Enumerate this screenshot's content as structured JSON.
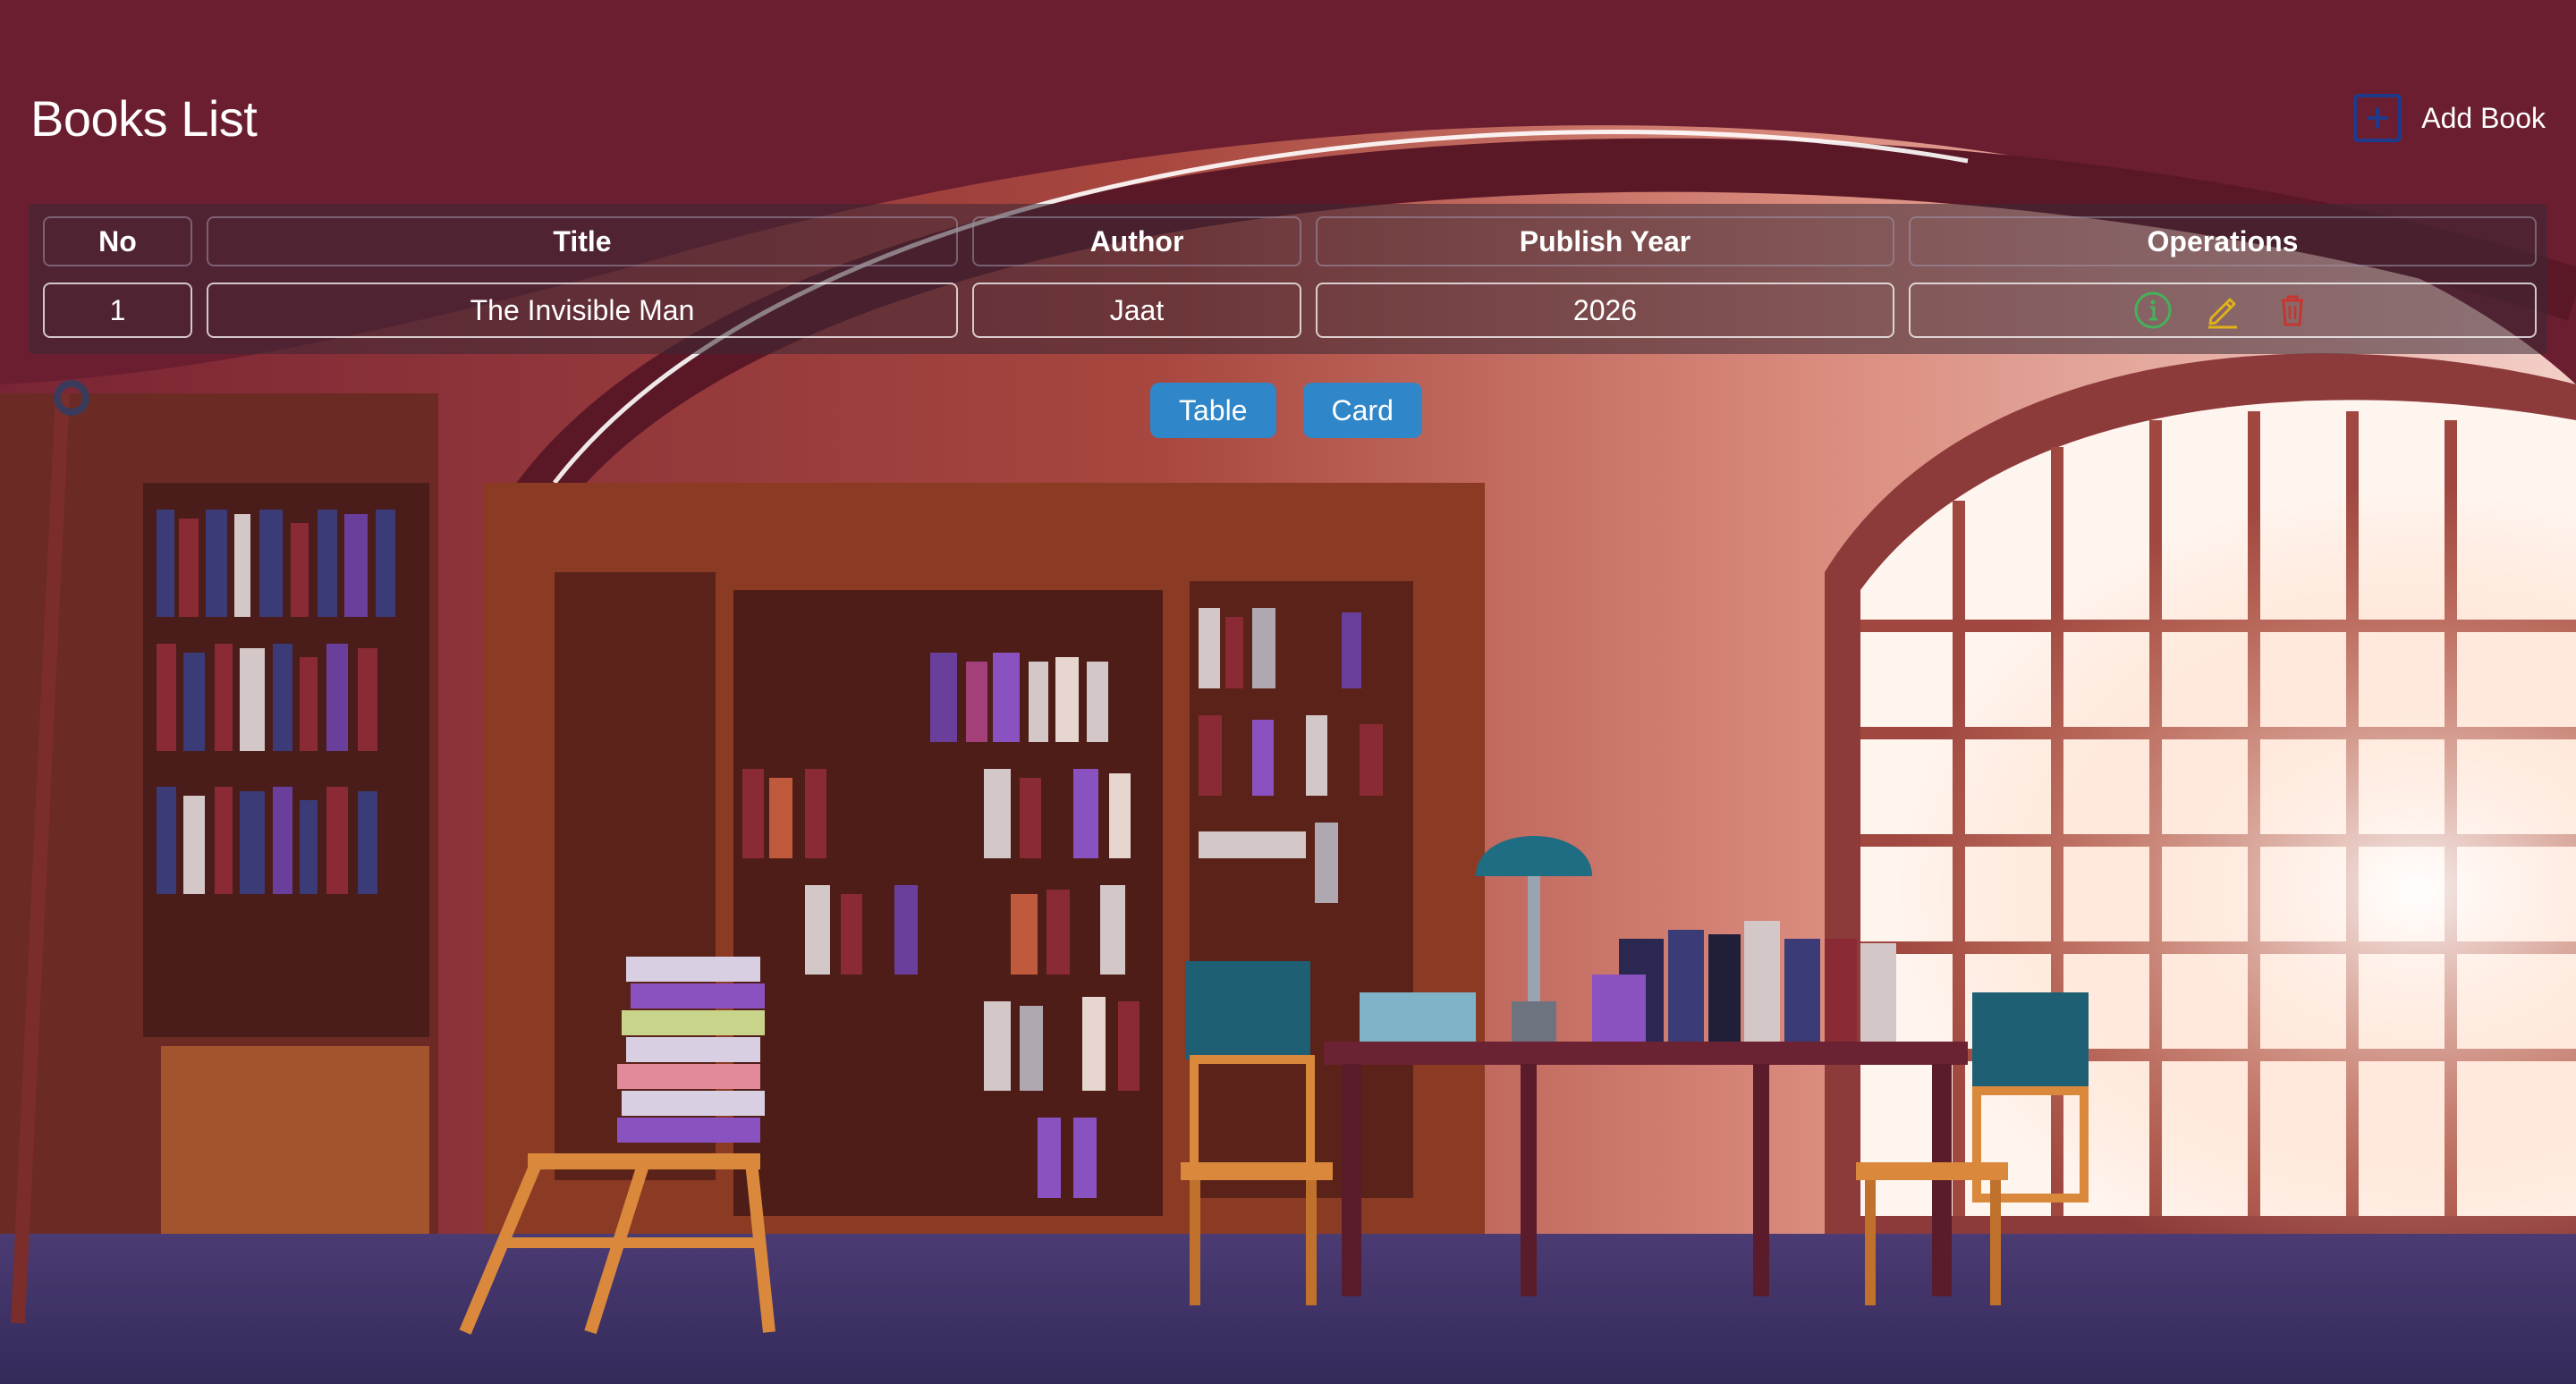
{
  "header": {
    "title": "Books List",
    "add_label": "Add Book",
    "add_icon": "plus-square-icon"
  },
  "table": {
    "columns": [
      "No",
      "Title",
      "Author",
      "Publish Year",
      "Operations"
    ],
    "rows": [
      {
        "no": "1",
        "title": "The Invisible Man",
        "author": "Jaat",
        "publish_year": "2026",
        "operations": [
          "info-icon",
          "edit-icon",
          "delete-icon"
        ]
      }
    ]
  },
  "view_toggle": {
    "table_label": "Table",
    "card_label": "Card"
  },
  "colors": {
    "accent_button": "#2f86c9",
    "info": "#46b05a",
    "edit": "#e0b11a",
    "delete": "#c7352f",
    "add_icon": "#1f3a8a"
  }
}
